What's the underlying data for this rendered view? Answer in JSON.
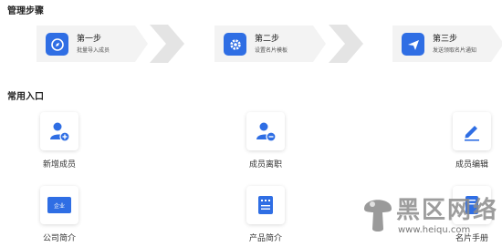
{
  "sections": {
    "management_steps": "管理步骤",
    "common_entries": "常用入口"
  },
  "steps": [
    {
      "name": "第一步",
      "desc": "批量导入成员",
      "icon": "compass-icon"
    },
    {
      "name": "第二步",
      "desc": "设置名片模板",
      "icon": "gear-icon"
    },
    {
      "name": "第三步",
      "desc": "发送领取名片通知",
      "icon": "paper-plane-icon"
    }
  ],
  "entries": [
    {
      "label": "新增成员",
      "icon": "add-user-icon"
    },
    {
      "label": "成员离职",
      "icon": "remove-user-icon"
    },
    {
      "label": "成员编辑",
      "icon": "edit-pencil-icon"
    },
    {
      "label": "公司简介",
      "icon": "company-card-icon",
      "badge": "企业"
    },
    {
      "label": "产品简介",
      "icon": "document-icon"
    },
    {
      "label": "名片手册",
      "icon": "book-icon"
    }
  ],
  "watermark": {
    "text": "黑区网络",
    "url": "www.heiqu.com"
  },
  "colors": {
    "accent": "#2f6ee4",
    "step_bg": "#f3f3f3",
    "chevron": "#e4e4e4"
  }
}
